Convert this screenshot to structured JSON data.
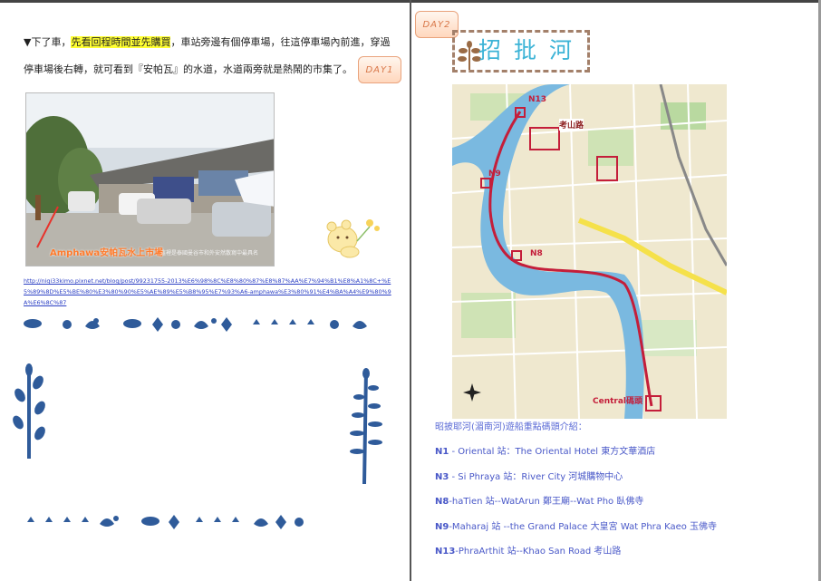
{
  "left_page": {
    "paragraph": {
      "prefix": "▼下了車，",
      "highlight": "先看回程時間並先購買",
      "suffix": "，車站旁邊有個停車場，往這停車場內前進，穿過停車場後右轉，就可看到『安帕瓦』的水道，水道兩旁就是熱鬧的市集了。"
    },
    "day_tag": "DAY1",
    "photo": {
      "caption": "Amphawa安帕瓦水上市場",
      "watermark": "這裡是泰國曼谷市和外安然散寫中最具名"
    },
    "link": "http://niqi33kimo.pixnet.net/blog/post/99231755-2013%E6%98%8C%E8%80%87%E8%87%AA%E7%94%B1%E8%A1%8C+%E5%89%8D%E5%BE%80%E3%80%90%E5%AE%89%E5%B8%95%E7%93%A6-amphawa%E3%80%91%E4%BA%A4%E9%80%9A%E6%8C%87"
  },
  "right_page": {
    "day_tag": "DAY2",
    "title": "招批河",
    "map": {
      "labels": {
        "n13": "N13",
        "n9": "N9",
        "n8": "N8",
        "khaosan": "考山路",
        "central": "Central碼頭"
      }
    },
    "intro": "昭披耶河(湄南河)遊船重點碼頭介紹：",
    "stations": [
      {
        "code": "N1",
        "text": " - Oriental 站：The Oriental Hotel 東方文華酒店"
      },
      {
        "code": "N3",
        "text": " - Si Phraya 站：River City 河城購物中心"
      },
      {
        "code": "N8",
        "text": "-haTien 站--WatArun 鄭王廟--Wat Pho 臥佛寺"
      },
      {
        "code": "N9",
        "text": "-Maharaj 站  --the Grand Palace 大皇宮 Wat Phra Kaeo 玉佛寺"
      },
      {
        "code": "N13",
        "text": "-PhraArthit 站--Khao San Road 考山路"
      }
    ]
  },
  "colors": {
    "highlight": "#ffff33",
    "link": "#2b3fc4",
    "station_text": "#4958c8",
    "title": "#3cb3d6",
    "route": "#c41e3a"
  }
}
